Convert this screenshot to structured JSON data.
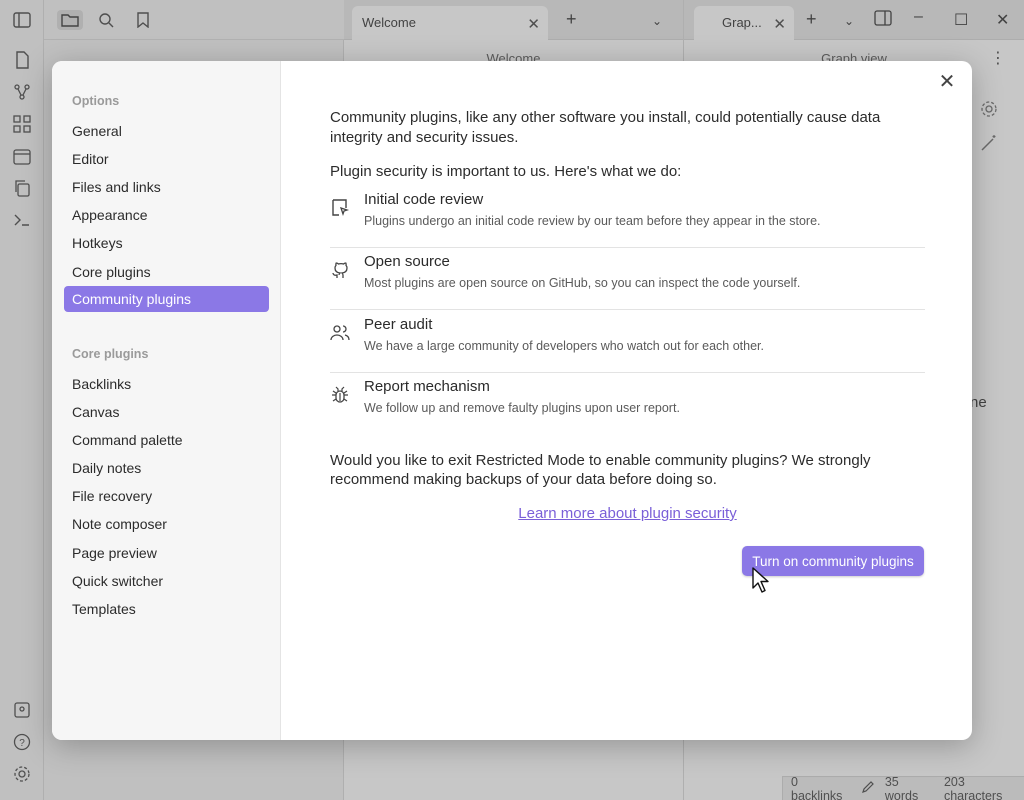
{
  "tabs": {
    "welcome_tab": "Welcome",
    "welcome_header": "Welcome",
    "graph_tab": "Grap...",
    "graph_header": "Graph view",
    "partial_text": "ne"
  },
  "statusbar": {
    "backlinks": "0 backlinks",
    "words": "35 words",
    "characters": "203 characters"
  },
  "settings_nav": {
    "options_heading": "Options",
    "options": [
      "General",
      "Editor",
      "Files and links",
      "Appearance",
      "Hotkeys",
      "Core plugins",
      "Community plugins"
    ],
    "core_heading": "Core plugins",
    "core_plugins": [
      "Backlinks",
      "Canvas",
      "Command palette",
      "Daily notes",
      "File recovery",
      "Note composer",
      "Page preview",
      "Quick switcher",
      "Templates"
    ]
  },
  "content": {
    "intro": "Community plugins, like any other software you install, could potentially cause data integrity and security issues.",
    "intro2": "Plugin security is important to us. Here's what we do:",
    "features": [
      {
        "title": "Initial code review",
        "desc": "Plugins undergo an initial code review by our team before they appear in the store.",
        "icon": "code-review-icon"
      },
      {
        "title": "Open source",
        "desc": "Most plugins are open source on GitHub, so you can inspect the code yourself.",
        "icon": "github-icon"
      },
      {
        "title": "Peer audit",
        "desc": "We have a large community of developers who watch out for each other.",
        "icon": "users-icon"
      },
      {
        "title": "Report mechanism",
        "desc": "We follow up and remove faulty plugins upon user report.",
        "icon": "bug-icon"
      }
    ],
    "question": "Would you like to exit Restricted Mode to enable community plugins? We strongly recommend making backups of your data before doing so.",
    "learn_more": "Learn more about plugin security",
    "cta": "Turn on community plugins"
  },
  "colors": {
    "accent": "#8b78e6",
    "link": "#7a5fd8"
  }
}
